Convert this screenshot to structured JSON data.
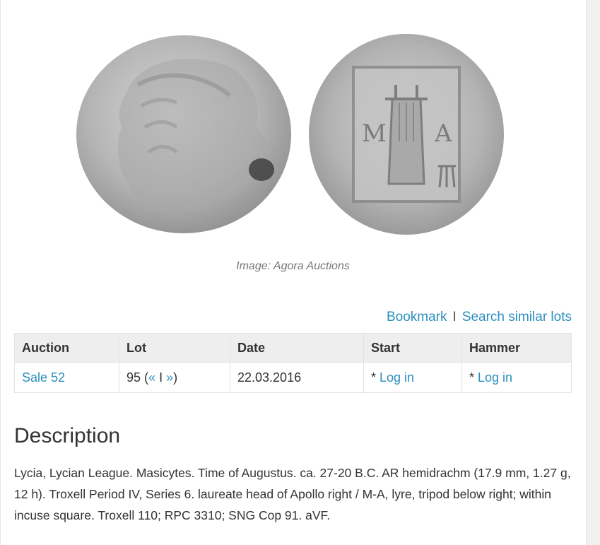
{
  "image": {
    "caption": "Image: Agora Auctions",
    "obverse_alt": "coin obverse: laureate head of Apollo",
    "reverse_alt": "coin reverse: lyre within incuse square, M-A"
  },
  "actions": {
    "bookmark": "Bookmark",
    "separator": "I",
    "search_similar": "Search similar lots"
  },
  "table": {
    "headers": [
      "Auction",
      "Lot",
      "Date",
      "Start",
      "Hammer"
    ],
    "row": {
      "auction": "Sale 52",
      "lot_number": "95",
      "lot_open": "(",
      "lot_prev": "«",
      "lot_sep": "I",
      "lot_next": "»",
      "lot_close": ")",
      "date": "22.03.2016",
      "start_prefix": "* ",
      "start_link": "Log in",
      "hammer_prefix": "* ",
      "hammer_link": "Log in"
    }
  },
  "description": {
    "title": "Description",
    "text": "Lycia, Lycian League. Masicytes. Time of Augustus. ca. 27-20 B.C. AR hemidrachm (17.9 mm, 1.27 g, 12 h). Troxell Period IV, Series 6. laureate head of Apollo right / M-A, lyre, tripod below right; within incuse square. Troxell 110; RPC 3310; SNG Cop 91. aVF."
  },
  "colors": {
    "link": "#2a8fbd",
    "header_bg": "#eeeeee",
    "coin": "#b9b9b9"
  }
}
